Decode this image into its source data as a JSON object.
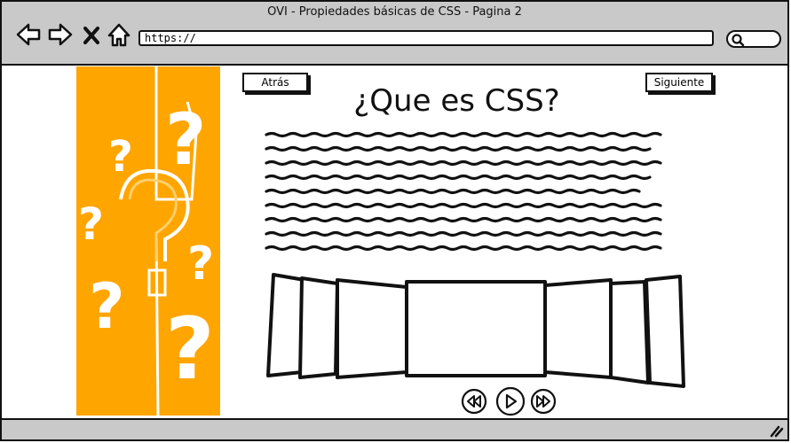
{
  "window": {
    "title": "OVI - Propiedades básicas de CSS - Pagina 2"
  },
  "browser": {
    "address": "https://",
    "icons": [
      "back-arrow-icon",
      "forward-arrow-icon",
      "close-x-icon",
      "home-icon",
      "search-icon"
    ]
  },
  "page": {
    "heading": "¿Que es CSS?",
    "prev_label": "Atrás",
    "next_label": "Siguiente",
    "sidebar_color": "#ffa500",
    "media_controls": [
      "rewind-icon",
      "play-icon",
      "fast-forward-icon"
    ]
  }
}
